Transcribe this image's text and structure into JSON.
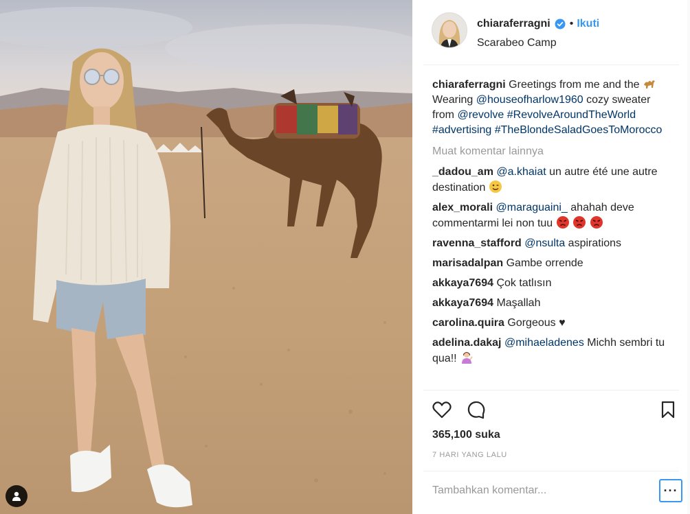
{
  "post": {
    "username": "chiaraferragni",
    "follow_label": "Ikuti",
    "separator": "•",
    "location": "Scarabeo Camp",
    "caption": {
      "text_1": "Greetings from me and the",
      "text_2": "Wearing",
      "mention_1": "@houseofharlow1960",
      "text_3": "cozy sweater from",
      "mention_2": "@revolve",
      "hashtag_1": "#RevolveAroundTheWorld",
      "hashtag_2": "#advertising",
      "hashtag_3": "#TheBlondeSaladGoesToMorocco"
    },
    "load_more_label": "Muat komentar lainnya",
    "comments": [
      {
        "user": "_dadou_am",
        "mention": "@a.khaiat",
        "text": "un autre été une autre destination"
      },
      {
        "user": "alex_morali",
        "mention": "@maraguaini_",
        "text": "ahahah deve commentarmi lei non tuu"
      },
      {
        "user": "ravenna_stafford",
        "mention": "@nsulta",
        "text": "aspirations"
      },
      {
        "user": "marisadalpan",
        "text": "Gambe orrende"
      },
      {
        "user": "akkaya7694",
        "text": "Çok tatlısın"
      },
      {
        "user": "akkaya7694",
        "text": "Maşallah"
      },
      {
        "user": "carolina.quira",
        "text": "Gorgeous ♥"
      },
      {
        "user": "adelina.dakaj",
        "mention": "@mihaeladenes",
        "text": "Michh sembri tu qua!!"
      }
    ],
    "likes": "365,100 suka",
    "timestamp": "7 HARI YANG LALU",
    "comment_placeholder": "Tambahkan komentar...",
    "more_options_label": "···"
  },
  "icons": {
    "verified": "verified-badge-icon",
    "like": "heart-icon",
    "comment": "comment-bubble-icon",
    "save": "bookmark-icon",
    "tagged_users": "user-tag-icon",
    "camel": "camel-emoji",
    "wink": "wink-emoji",
    "angry": "angry-face-emoji",
    "shrug": "person-tipping-hand-emoji"
  },
  "colors": {
    "link": "#003569",
    "accent": "#3897f0",
    "muted": "#999999",
    "text": "#262626"
  }
}
